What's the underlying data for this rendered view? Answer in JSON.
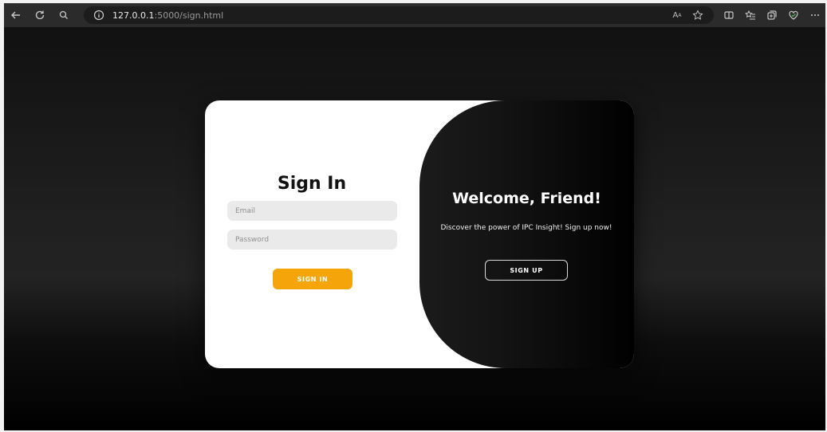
{
  "browser": {
    "url_host": "127.0.0.1",
    "url_rest": ":5000/sign.html",
    "icons": [
      "back-icon",
      "refresh-icon",
      "search-icon",
      "info-icon",
      "read-aloud-icon",
      "favorite-star-icon",
      "split-screen-icon",
      "favorites-icon",
      "collections-icon",
      "copilot-icon",
      "more-icon"
    ]
  },
  "signin": {
    "title": "Sign In",
    "email_placeholder": "Email",
    "password_placeholder": "Password",
    "button_label": "SIGN IN",
    "button_color": "#f5a50a"
  },
  "welcome": {
    "title": "Welcome, Friend!",
    "message": "Discover the power of IPC Insight! Sign up now!",
    "button_label": "SIGN UP"
  }
}
